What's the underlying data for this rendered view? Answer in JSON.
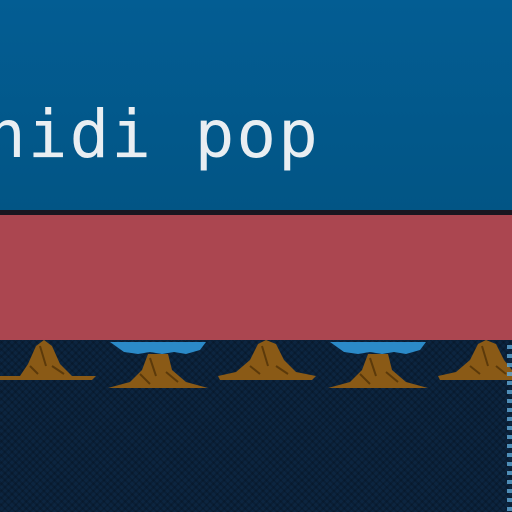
{
  "header": {
    "title": "nidi pop"
  },
  "colors": {
    "header_blue": "#035d93",
    "band_red": "#ab4650",
    "field_navy": "#0c2540",
    "mound_brown": "#8a5a16",
    "cap_blue": "#2b8ac8"
  },
  "terrain": {
    "tile_icon": "mound-icon",
    "tile_count": 5
  }
}
